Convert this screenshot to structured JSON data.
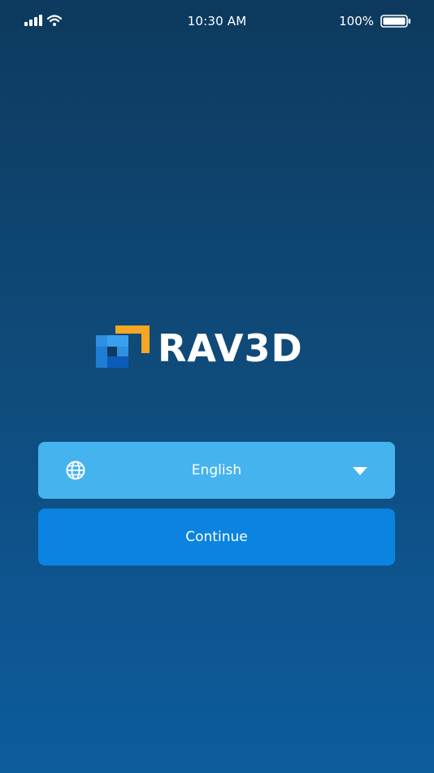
{
  "status_bar": {
    "time": "10:30 AM",
    "battery_percent": "100%",
    "icons": [
      "signal-icon",
      "wifi-icon",
      "battery-icon"
    ]
  },
  "logo": {
    "text": "RAV3D",
    "colors": {
      "accent": "#f5a623",
      "blue_light": "#2f8fe0",
      "blue_dark": "#0a5cb8"
    }
  },
  "language_select": {
    "icon": "globe-icon",
    "value": "English",
    "dropdown_icon": "chevron-down-icon"
  },
  "continue_button": {
    "label": "Continue"
  },
  "colors": {
    "select_bg": "#45b3ee",
    "button_bg": "#0a84e0",
    "background_top": "#0d3a5e",
    "background_bottom": "#0d5c9e"
  }
}
